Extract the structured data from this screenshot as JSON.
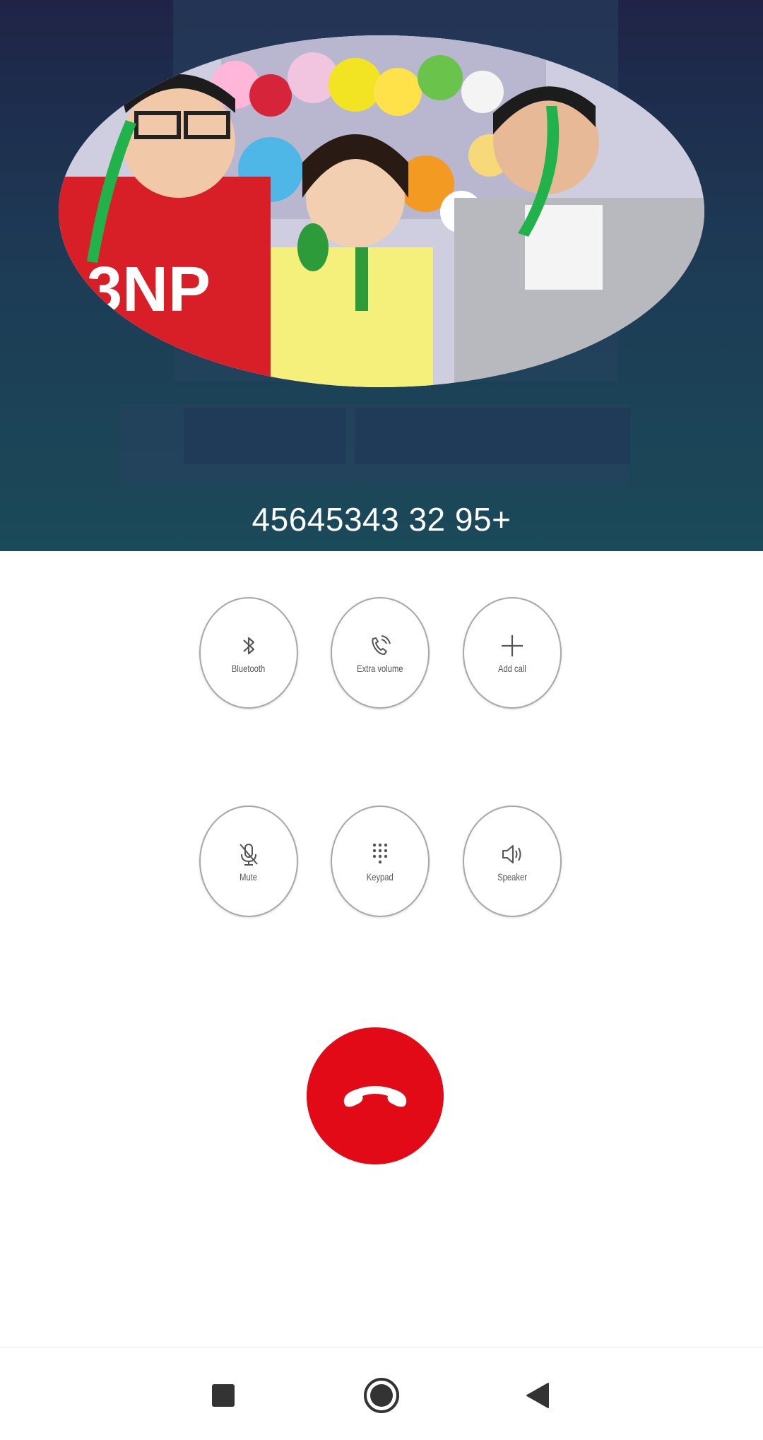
{
  "call": {
    "caller_number": "45645343 32 95+"
  },
  "controls": [
    {
      "label": "Bluetooth",
      "icon": "bluetooth-icon"
    },
    {
      "label": "Extra volume",
      "icon": "extra-volume-icon"
    },
    {
      "label": "Add call",
      "icon": "add-call-icon"
    },
    {
      "label": "Mute",
      "icon": "mute-icon"
    },
    {
      "label": "Keypad",
      "icon": "keypad-icon"
    },
    {
      "label": "Speaker",
      "icon": "speaker-icon"
    }
  ],
  "end_call": {
    "icon": "end-call-icon"
  },
  "navigation": {
    "recents_icon": "square-icon",
    "home_icon": "circle-icon",
    "back_icon": "triangle-back-icon"
  },
  "colors": {
    "header_top": "#1f2447",
    "header_bottom": "#1b4a59",
    "end_call": "#e30a17"
  }
}
